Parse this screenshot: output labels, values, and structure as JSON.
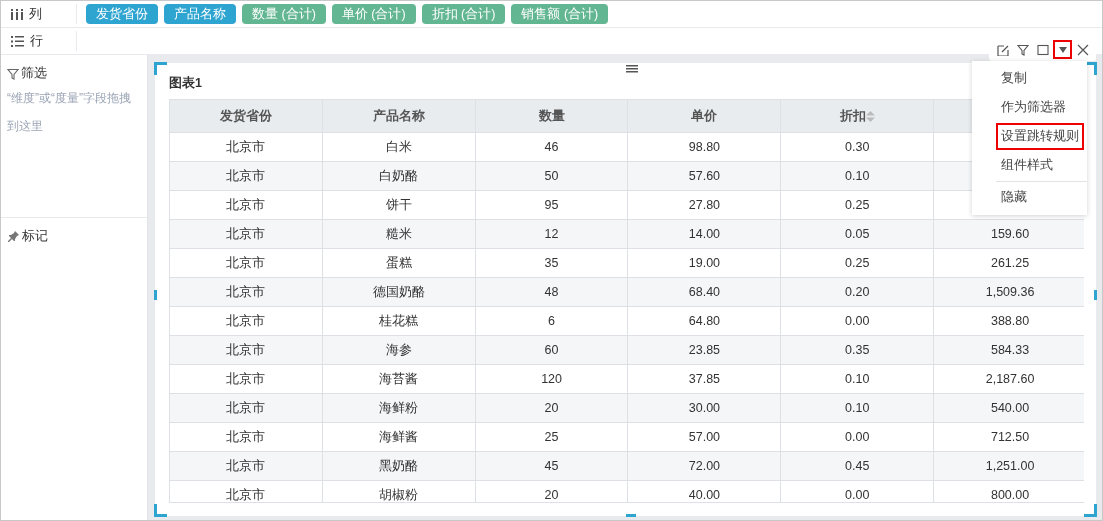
{
  "shelves": [
    {
      "kind": "columns",
      "label": "列",
      "fields": [
        {
          "label": "发货省份",
          "color": "#2ea4d0"
        },
        {
          "label": "产品名称",
          "color": "#2ea4d0"
        },
        {
          "label": "数量 (合计)",
          "color": "#63b692"
        },
        {
          "label": "单价 (合计)",
          "color": "#63b692"
        },
        {
          "label": "折扣 (合计)",
          "color": "#63b692"
        },
        {
          "label": "销售额 (合计)",
          "color": "#63b692"
        }
      ]
    },
    {
      "kind": "rows",
      "label": "行"
    }
  ],
  "sidebar": {
    "filter": {
      "label": "筛选",
      "hint": "“维度”或“度量”字段拖拽到这里"
    },
    "marks": {
      "label": "标记"
    }
  },
  "widget": {
    "title": "图表1",
    "toolbar": [
      {
        "kind": "edit",
        "highlighted": false
      },
      {
        "kind": "filter",
        "highlighted": false
      },
      {
        "kind": "maximize",
        "highlighted": false
      },
      {
        "kind": "dropdown",
        "highlighted": true
      },
      {
        "kind": "close",
        "highlighted": false
      }
    ],
    "table": {
      "columns": [
        {
          "label": "发货省份"
        },
        {
          "label": "产品名称"
        },
        {
          "label": "数量"
        },
        {
          "label": "单价"
        },
        {
          "label": "折扣",
          "sortable": true
        }
      ],
      "rows": [
        [
          "北京市",
          "白米",
          "46",
          "98.80",
          "0.30",
          null
        ],
        [
          "北京市",
          "白奶酪",
          "50",
          "57.60",
          "0.10",
          null
        ],
        [
          "北京市",
          "饼干",
          "95",
          "27.80",
          "0.25",
          null
        ],
        [
          "北京市",
          "糙米",
          "12",
          "14.00",
          "0.05",
          "159.60"
        ],
        [
          "北京市",
          "蛋糕",
          "35",
          "19.00",
          "0.25",
          "261.25"
        ],
        [
          "北京市",
          "德国奶酪",
          "48",
          "68.40",
          "0.20",
          "1,509.36"
        ],
        [
          "北京市",
          "桂花糕",
          "6",
          "64.80",
          "0.00",
          "388.80"
        ],
        [
          "北京市",
          "海参",
          "60",
          "23.85",
          "0.35",
          "584.33"
        ],
        [
          "北京市",
          "海苔酱",
          "120",
          "37.85",
          "0.10",
          "2,187.60"
        ],
        [
          "北京市",
          "海鲜粉",
          "20",
          "30.00",
          "0.10",
          "540.00"
        ],
        [
          "北京市",
          "海鲜酱",
          "25",
          "57.00",
          "0.00",
          "712.50"
        ],
        [
          "北京市",
          "黑奶酪",
          "45",
          "72.00",
          "0.45",
          "1,251.00"
        ],
        [
          "北京市",
          "胡椒粉",
          "20",
          "40.00",
          "0.00",
          "800.00"
        ]
      ]
    },
    "menu": [
      {
        "label": "复制",
        "highlighted": false,
        "divider_before": false
      },
      {
        "label": "作为筛选器",
        "highlighted": false,
        "divider_before": false
      },
      {
        "label": "设置跳转规则",
        "highlighted": true,
        "divider_before": false
      },
      {
        "label": "组件样式",
        "highlighted": false,
        "divider_before": false
      },
      {
        "label": "隐藏",
        "highlighted": false,
        "divider_before": true
      }
    ]
  }
}
